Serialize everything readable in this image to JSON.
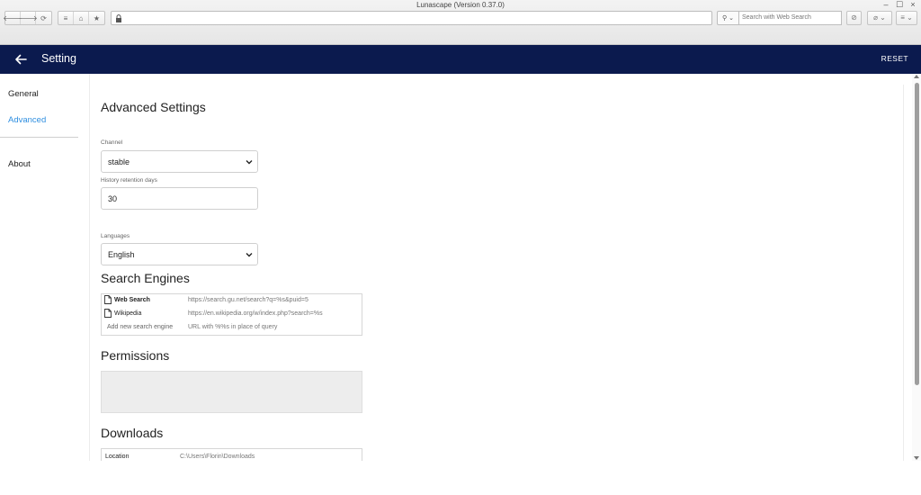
{
  "window": {
    "title": "Lunascape (Version 0.37.0)",
    "controls": {
      "minimize": "–",
      "maximize": "☐",
      "close": "×"
    }
  },
  "toolbar": {
    "back": "🡐",
    "forward": "🡒",
    "reload": "⟳",
    "menu_list": "≡",
    "home": "⌂",
    "bookmark": "★",
    "url_value": "",
    "search_engine_glyph": "⚲ ⌄",
    "search_placeholder": "Search with Web Search",
    "block_glyph": "⊘",
    "clip_glyph": "⌀ ⌄",
    "menu_glyph": "≡ ⌄"
  },
  "header": {
    "title": "Setting",
    "reset_label": "RESET"
  },
  "sidebar": {
    "items": [
      {
        "label": "General",
        "active": false
      },
      {
        "label": "Advanced",
        "active": true
      },
      {
        "label": "About",
        "active": false
      }
    ]
  },
  "main": {
    "title": "Advanced Settings",
    "channel": {
      "label": "Channel",
      "value": "stable"
    },
    "history": {
      "label": "History retention days",
      "value": "30"
    },
    "languages": {
      "label": "Languages",
      "value": "English"
    },
    "search_engines": {
      "title": "Search Engines",
      "rows": [
        {
          "name": "Web Search",
          "url": "https://search.gu.net/search?q=%s&puid=5"
        },
        {
          "name": "Wikipedia",
          "url": "https://en.wikipedia.org/w/index.php?search=%s"
        }
      ],
      "add_name_placeholder": "Add new search engine",
      "add_url_placeholder": "URL with %%s in place of query"
    },
    "permissions": {
      "title": "Permissions"
    },
    "downloads": {
      "title": "Downloads",
      "location_label": "Location",
      "location_value": "C:\\Users\\Florin\\Downloads"
    }
  },
  "colors": {
    "header_bg": "#0b1a4e",
    "accent": "#2f8fe0"
  },
  "icons": {
    "back": "arrow-left-icon",
    "lock": "lock-icon",
    "caret": "chevron-down-icon",
    "document": "document-icon",
    "home": "home-icon",
    "star": "star-icon"
  }
}
